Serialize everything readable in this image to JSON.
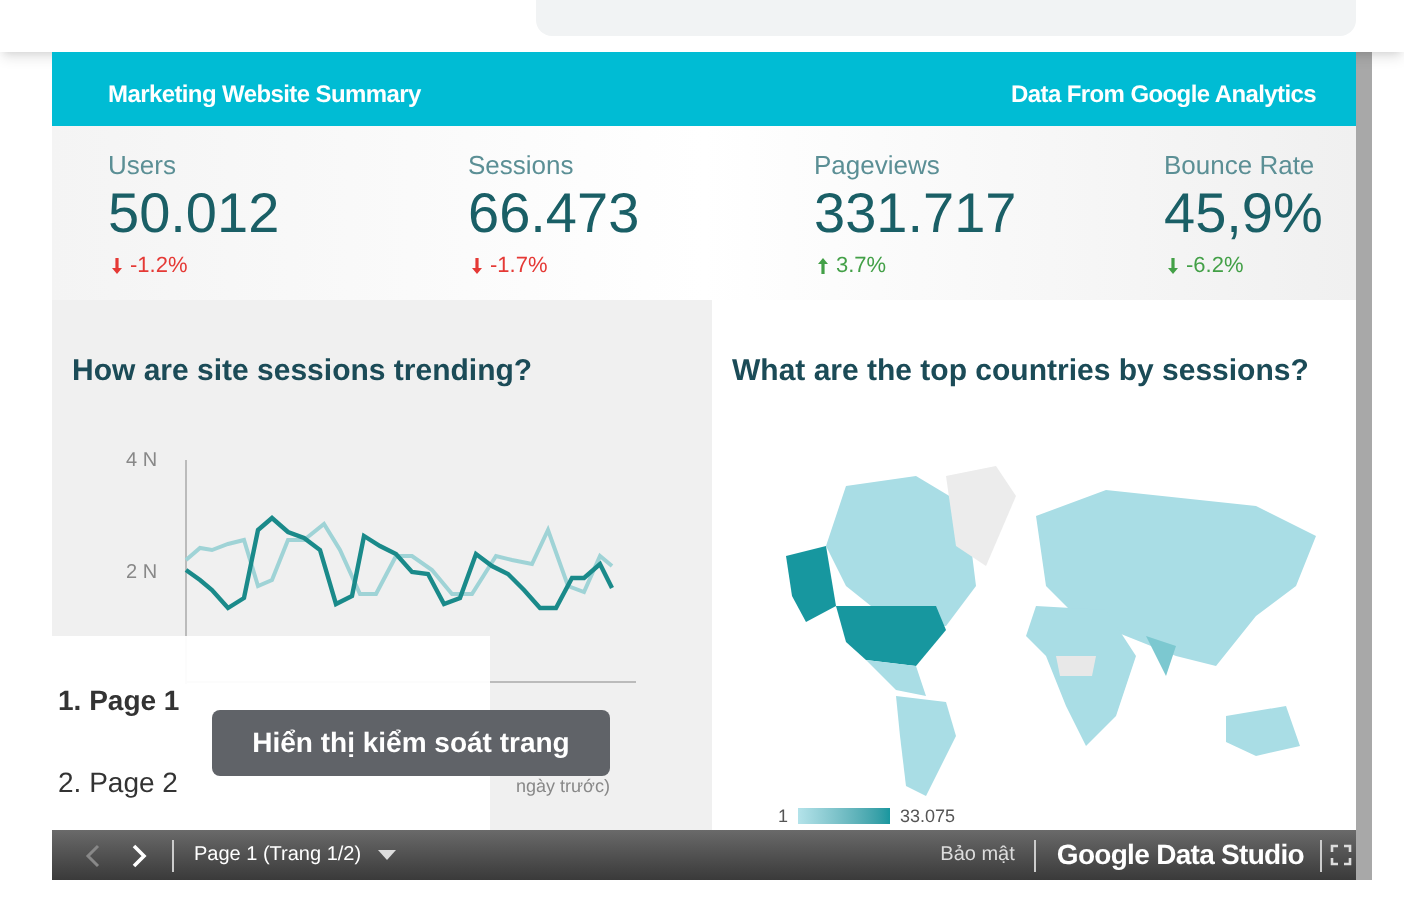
{
  "header": {
    "title": "Marketing Website Summary",
    "source": "Data From Google Analytics"
  },
  "metrics": [
    {
      "label": "Users",
      "value": "50.012",
      "change": "-1.2%",
      "kind": "down"
    },
    {
      "label": "Sessions",
      "value": "66.473",
      "change": "-1.7%",
      "kind": "down"
    },
    {
      "label": "Pageviews",
      "value": "331.717",
      "change": "3.7%",
      "kind": "up"
    },
    {
      "label": "Bounce Rate",
      "value": "45,9%",
      "change": "-6.2%",
      "kind": "fall"
    }
  ],
  "trend_panel": {
    "title": "How are site sessions trending?",
    "y_ticks": [
      "4 N",
      "2 N"
    ],
    "legend_fragment": "ngày trước)"
  },
  "map_panel": {
    "title": "What are the top countries by sessions?",
    "legend_min": "1",
    "legend_max": "33.075"
  },
  "page_menu": [
    {
      "number": "1.",
      "label": "Page 1",
      "selected": true
    },
    {
      "number": "2.",
      "label": "Page 2",
      "selected": false
    }
  ],
  "tooltip": "Hiển thị kiểm soát trang",
  "footer": {
    "page": "Page 1 (Trang 1/2)",
    "privacy": "Bảo mật",
    "brand": "Google Data Studio"
  }
}
